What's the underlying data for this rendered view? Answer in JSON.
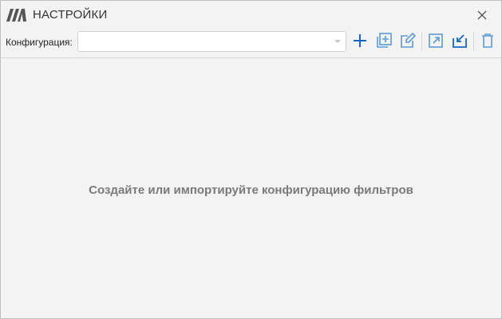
{
  "window": {
    "title": "НАСТРОЙКИ",
    "logo_icon": "logo-icon",
    "close_icon": "close-icon"
  },
  "toolbar": {
    "config_label": "Конфигурация:",
    "config_value": "",
    "buttons": [
      {
        "name": "add-icon",
        "color": "#1565c0"
      },
      {
        "name": "duplicate-icon",
        "color": "#5b9bd5"
      },
      {
        "name": "edit-icon",
        "color": "#5b9bd5"
      },
      {
        "name": "export-icon",
        "color": "#5b9bd5"
      },
      {
        "name": "import-icon",
        "color": "#1565c0"
      },
      {
        "name": "delete-icon",
        "color": "#5b9bd5"
      }
    ]
  },
  "main": {
    "empty_message": "Создайте или импортируйте конфигурацию фильтров"
  },
  "colors": {
    "accent": "#1565c0",
    "accent_light": "#5b9bd5",
    "background": "#f3f3f3",
    "muted_text": "#7a7a7a"
  }
}
